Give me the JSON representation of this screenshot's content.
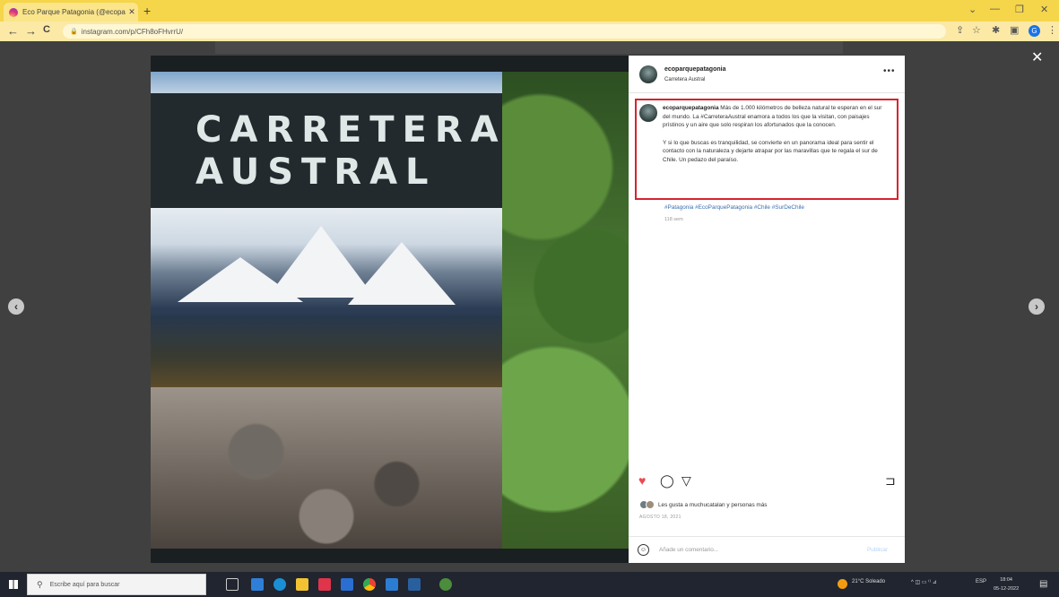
{
  "browser": {
    "tab_title": "Eco Parque Patagonia (@ecopa",
    "tab_close": "✕",
    "new_tab": "+",
    "url": "instagram.com/p/CFh8oFHvrrU/",
    "nav": {
      "back": "←",
      "forward": "→",
      "reload": "C"
    },
    "window_controls": {
      "chevron": "⌄",
      "minimize": "—",
      "restore": "❐",
      "close": "✕"
    },
    "profile_initial": "G"
  },
  "modal": {
    "close": "✕",
    "prev": "‹",
    "next": "›"
  },
  "post_image": {
    "title_line1": "CARRETERA",
    "title_line2": "AUSTRAL"
  },
  "panel": {
    "username": "ecoparquepatagonia",
    "location": "Carretera Austral",
    "more": "•••",
    "caption_user": "ecoparquepatagonia",
    "caption_p1": "Más de 1.000 kilómetros de belleza natural te esperan en el sur del mundo. La #CarreteraAustral enamora a todos los que la visitan, con paisajes prístinos y un aire que solo respiran los afortunados que la conocen.",
    "caption_p2": "Y si lo que buscas es tranquilidad, se convierte en un panorama ideal para sentir el contacto con la naturaleza y dejarte atrapar por las maravillas que te regala el sur de Chile. Un pedazo del paraíso.",
    "hashtags": "#Patagonia #EcoParquePatagonia #Chile #SurDeChile",
    "caption_time": "118 sem",
    "likes_text": "Les gusta a muchucatalan y personas más",
    "date": "AGOSTO 18, 2021",
    "comment_placeholder": "Añade un comentario...",
    "publish": "Publicar",
    "emoji": "☺"
  },
  "taskbar": {
    "search_placeholder": "Escribe aquí para buscar",
    "weather": "21°C Soleado",
    "lang": "ESP",
    "tray_status": "^ ◫ ▭ ⁽⁾ ⊿",
    "time": "18:04",
    "date": "05-12-2022"
  },
  "colors": {
    "tab_strip": "#f5d54a",
    "caption_highlight": "#d6232f",
    "like_heart": "#ed4956",
    "link": "#3a6fb0"
  }
}
